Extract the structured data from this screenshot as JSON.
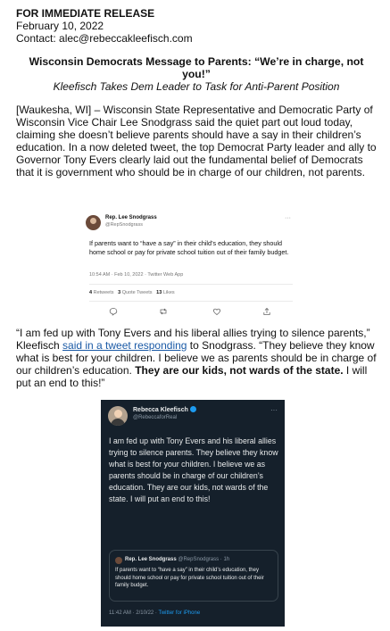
{
  "header": {
    "release": "FOR IMMEDIATE RELEASE",
    "date": "February 10, 2022",
    "contact": "Contact: alec@rebeccakleefisch.com"
  },
  "title": "Wisconsin Democrats Message to Parents: “We’re in charge, not you!”",
  "subtitle": "Kleefisch Takes Dem Leader to Task for Anti-Parent Position",
  "paragraph1": "[Waukesha, WI] – Wisconsin State Representative and Democratic Party of Wisconsin Vice Chair Lee Snodgrass said the quiet part out loud today, claiming she doesn’t believe parents should have a say in their children’s education. In a now deleted tweet, the top Democrat Party leader and ally to Governor Tony Evers clearly laid out the fundamental belief of Democrats that it is government who should be in charge of our children, not parents.",
  "tweet1": {
    "name": "Rep. Lee Snodgrass",
    "handle": "@RepSnodgrass",
    "text": "If parents want to “have a say” in their child’s education, they should home school or pay for private school tuition out of their family budget.",
    "meta": "10:54 AM · Feb 10, 2022 · Twitter Web App",
    "retweets": "4",
    "retweets_label": "Retweets",
    "quotes": "3",
    "quotes_label": "Quote Tweets",
    "likes": "13",
    "likes_label": "Likes"
  },
  "paragraph2": {
    "part1": "“I am fed up with Tony Evers and his liberal allies trying to silence parents,” Kleefisch ",
    "link": "said in a tweet responding",
    "part2": " to Snodgrass. “They believe they know what is best for your children. I believe we as parents should be in charge of our children’s education. ",
    "bold": "They are our kids, not wards of the state.",
    "part3": " I will put an end to this!”"
  },
  "tweet2": {
    "name": "Rebecca Kleefisch",
    "handle": "@RebeccaforReal",
    "text": "I am fed up with Tony Evers and his liberal allies trying to silence parents. They believe they know what is best for your children. I believe we as parents should be in charge of our children’s education. They are our kids, not wards of the state. I will put an end to this!",
    "quote_name": "Rep. Lee Snodgrass",
    "quote_handle": "@RepSnodgrass · 1h",
    "quote_text": "If parents want to “have a say” in their child’s education, they should home school or pay for private school tuition out of their family budget.",
    "meta_time": "11:42 AM · 2/10/22 · ",
    "meta_source": "Twitter for iPhone"
  },
  "icons": [
    "reply-icon",
    "retweet-icon",
    "like-icon",
    "share-icon",
    "verified-icon",
    "more-icon"
  ]
}
